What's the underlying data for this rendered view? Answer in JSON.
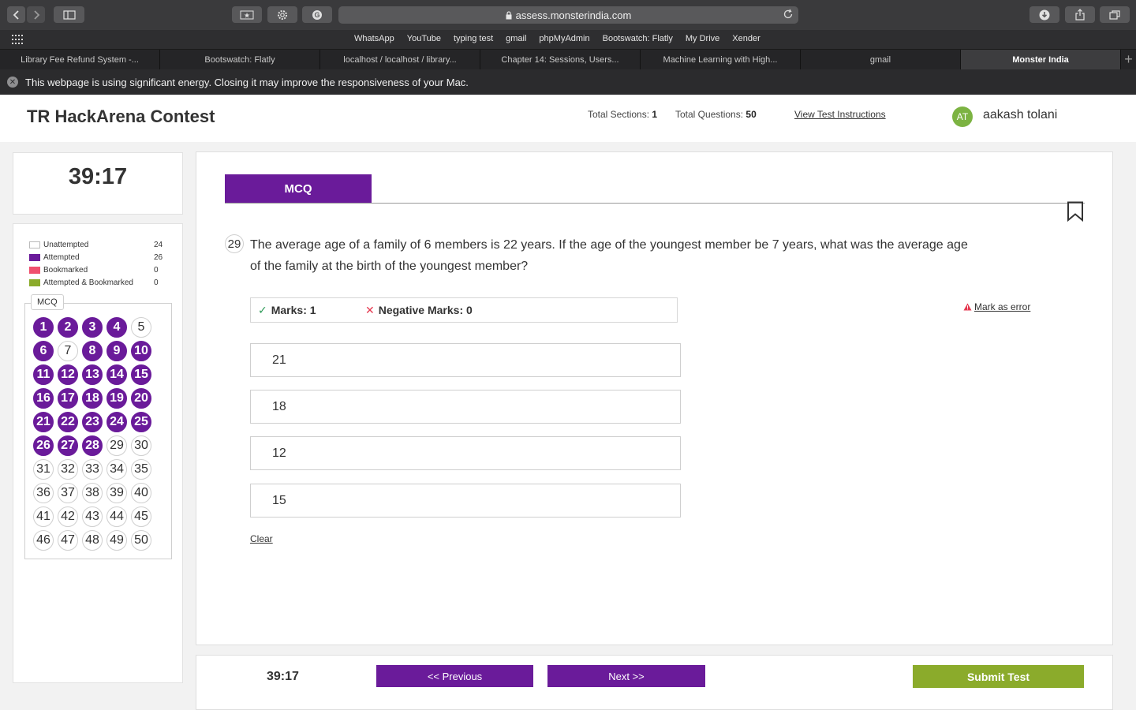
{
  "browser": {
    "url": "assess.monsterindia.com",
    "bookmarks": [
      "WhatsApp",
      "YouTube",
      "typing test",
      "gmail",
      "phpMyAdmin",
      "Bootswatch: Flatly",
      "My Drive",
      "Xender"
    ],
    "tabs": [
      {
        "label": "Library Fee Refund System -..."
      },
      {
        "label": "Bootswatch: Flatly"
      },
      {
        "label": "localhost / localhost / library..."
      },
      {
        "label": "Chapter 14: Sessions, Users..."
      },
      {
        "label": "Machine Learning with High..."
      },
      {
        "label": "gmail"
      },
      {
        "label": "Monster India"
      }
    ],
    "energy_warning": "This webpage is using significant energy. Closing it may improve the responsiveness of your Mac."
  },
  "header": {
    "title": "TR HackArena Contest",
    "sections_label": "Total Sections:",
    "sections_value": "1",
    "questions_label": "Total Questions:",
    "questions_value": "50",
    "instructions_link": "View Test Instructions",
    "user_initials": "AT",
    "user_name": "aakash tolani"
  },
  "sidebar": {
    "timer": "39:17",
    "legend": [
      {
        "label": "Unattempted",
        "count": "24",
        "color": "#ffffff"
      },
      {
        "label": "Attempted",
        "count": "26",
        "color": "#6a1b9a"
      },
      {
        "label": "Bookmarked",
        "count": "0",
        "color": "#f0506e"
      },
      {
        "label": "Attempted & Bookmarked",
        "count": "0",
        "color": "#8bab2b"
      }
    ],
    "section_label": "MCQ",
    "questions": [
      {
        "n": "1",
        "state": "attempted"
      },
      {
        "n": "2",
        "state": "attempted"
      },
      {
        "n": "3",
        "state": "attempted"
      },
      {
        "n": "4",
        "state": "attempted"
      },
      {
        "n": "5",
        "state": "unattempted"
      },
      {
        "n": "6",
        "state": "attempted"
      },
      {
        "n": "7",
        "state": "unattempted"
      },
      {
        "n": "8",
        "state": "attempted"
      },
      {
        "n": "9",
        "state": "attempted"
      },
      {
        "n": "10",
        "state": "attempted"
      },
      {
        "n": "11",
        "state": "attempted"
      },
      {
        "n": "12",
        "state": "attempted"
      },
      {
        "n": "13",
        "state": "attempted"
      },
      {
        "n": "14",
        "state": "attempted"
      },
      {
        "n": "15",
        "state": "attempted"
      },
      {
        "n": "16",
        "state": "attempted"
      },
      {
        "n": "17",
        "state": "attempted"
      },
      {
        "n": "18",
        "state": "attempted"
      },
      {
        "n": "19",
        "state": "attempted"
      },
      {
        "n": "20",
        "state": "attempted"
      },
      {
        "n": "21",
        "state": "attempted"
      },
      {
        "n": "22",
        "state": "attempted"
      },
      {
        "n": "23",
        "state": "attempted"
      },
      {
        "n": "24",
        "state": "attempted"
      },
      {
        "n": "25",
        "state": "attempted"
      },
      {
        "n": "26",
        "state": "attempted"
      },
      {
        "n": "27",
        "state": "attempted"
      },
      {
        "n": "28",
        "state": "attempted"
      },
      {
        "n": "29",
        "state": "unattempted"
      },
      {
        "n": "30",
        "state": "unattempted"
      },
      {
        "n": "31",
        "state": "unattempted"
      },
      {
        "n": "32",
        "state": "unattempted"
      },
      {
        "n": "33",
        "state": "unattempted"
      },
      {
        "n": "34",
        "state": "unattempted"
      },
      {
        "n": "35",
        "state": "unattempted"
      },
      {
        "n": "36",
        "state": "unattempted"
      },
      {
        "n": "37",
        "state": "unattempted"
      },
      {
        "n": "38",
        "state": "unattempted"
      },
      {
        "n": "39",
        "state": "unattempted"
      },
      {
        "n": "40",
        "state": "unattempted"
      },
      {
        "n": "41",
        "state": "unattempted"
      },
      {
        "n": "42",
        "state": "unattempted"
      },
      {
        "n": "43",
        "state": "unattempted"
      },
      {
        "n": "44",
        "state": "unattempted"
      },
      {
        "n": "45",
        "state": "unattempted"
      },
      {
        "n": "46",
        "state": "unattempted"
      },
      {
        "n": "47",
        "state": "unattempted"
      },
      {
        "n": "48",
        "state": "unattempted"
      },
      {
        "n": "49",
        "state": "unattempted"
      },
      {
        "n": "50",
        "state": "unattempted"
      }
    ]
  },
  "question": {
    "section_tab": "MCQ",
    "number": "29",
    "text": "The average age of a family of 6 members is 22 years. If the age of the youngest member be 7 years, what was the average age of the family at the birth of the youngest member?",
    "marks": "Marks: 1",
    "negative_marks": "Negative Marks: 0",
    "mark_error": "Mark as error",
    "options": [
      "21",
      "18",
      "12",
      "15"
    ],
    "clear": "Clear"
  },
  "footer": {
    "timer": "39:17",
    "previous": "<< Previous",
    "next": "Next >>",
    "submit": "Submit Test"
  },
  "colors": {
    "accent": "#6a1b9a",
    "submit": "#8bab2b",
    "bookmarked": "#f0506e",
    "avatar": "#7cb342"
  }
}
